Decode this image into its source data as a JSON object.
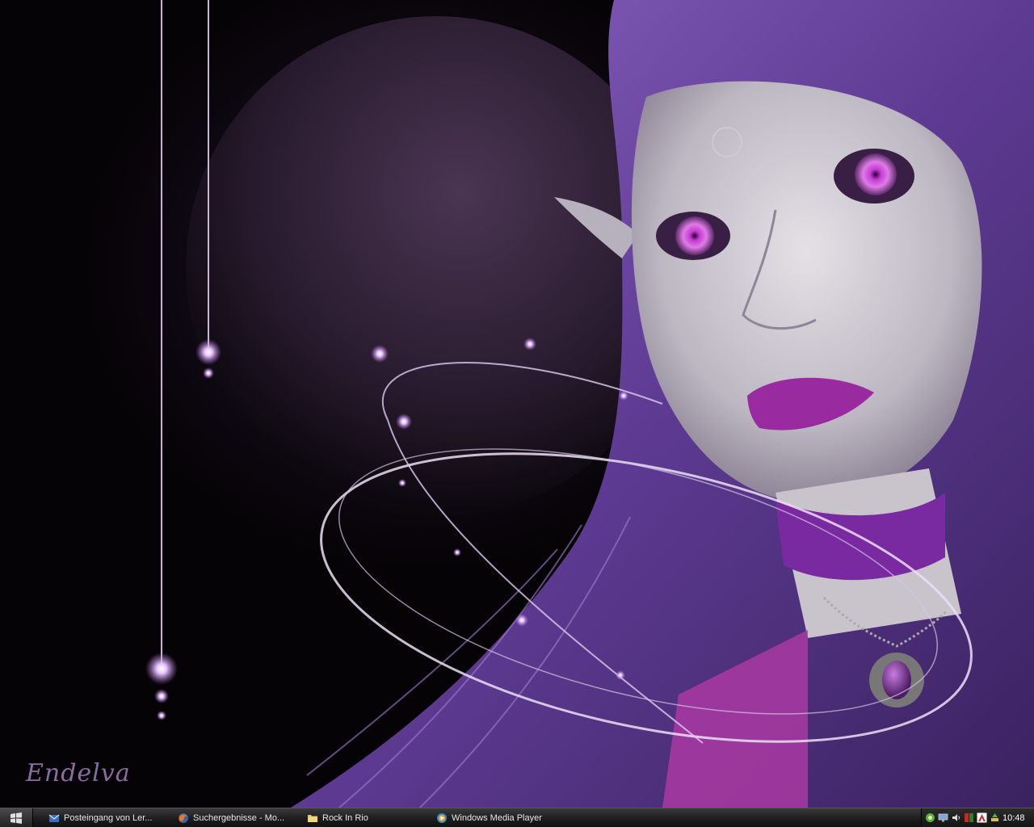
{
  "desktop": {
    "wallpaper": {
      "signature": "Endelva",
      "accent": "#8b3fb5",
      "hair_color": "#6a3d9a"
    }
  },
  "taskbar": {
    "start_icon": "windows-logo-icon",
    "tasks": [
      {
        "label": "Posteingang von Ler...",
        "icon": "outlook-icon"
      },
      {
        "label": "Suchergebnisse - Mo...",
        "icon": "firefox-icon"
      },
      {
        "label": "Rock In Rio",
        "icon": "folder-icon"
      },
      {
        "label": "Windows Media Player",
        "icon": "media-player-icon"
      }
    ],
    "tray": {
      "icons": [
        "network-icon",
        "monitor-icon",
        "volume-icon",
        "meter-icon",
        "antivirus-icon",
        "safely-remove-icon"
      ],
      "clock": "10:48"
    }
  }
}
